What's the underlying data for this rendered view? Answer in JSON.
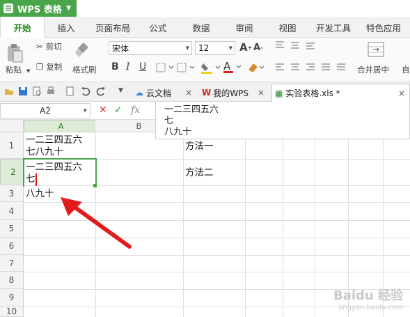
{
  "app": {
    "title": "WPS 表格"
  },
  "menu": [
    "开始",
    "插入",
    "页面布局",
    "公式",
    "数据",
    "审阅",
    "视图",
    "开发工具",
    "特色应用"
  ],
  "toolbar": {
    "paste": "粘贴",
    "cut": "剪切",
    "copy": "复制",
    "format_painter": "格式刷",
    "font_name": "宋体",
    "font_size": "12",
    "merge_center": "合并居中",
    "auto_line": "自"
  },
  "tabs": [
    {
      "label": "云文档"
    },
    {
      "label": "我的WPS"
    },
    {
      "label": "实验表格.xls *"
    }
  ],
  "formula_bar": {
    "name_box": "A2",
    "fx": "fx",
    "content_lines": [
      "一二三四五六",
      "七",
      "八九十"
    ]
  },
  "columns": [
    "A",
    "B"
  ],
  "rows": [
    "1",
    "2",
    "3",
    "4",
    "5",
    "6",
    "7",
    "8",
    "9",
    "10"
  ],
  "cells": {
    "A1": [
      "一二三四五六",
      "七八九十"
    ],
    "A2": [
      "一二三四五六",
      "七"
    ],
    "A3": "八九十",
    "C1": "方法一",
    "C2": "方法二"
  },
  "annotation": {
    "arrow_color": "#e21c1c"
  },
  "watermark": {
    "text": "Baidu 经验",
    "sub": "jingyan.baidu.com"
  },
  "colors": {
    "accent": "#4aa44a",
    "selected_header": "#dcecd6"
  }
}
